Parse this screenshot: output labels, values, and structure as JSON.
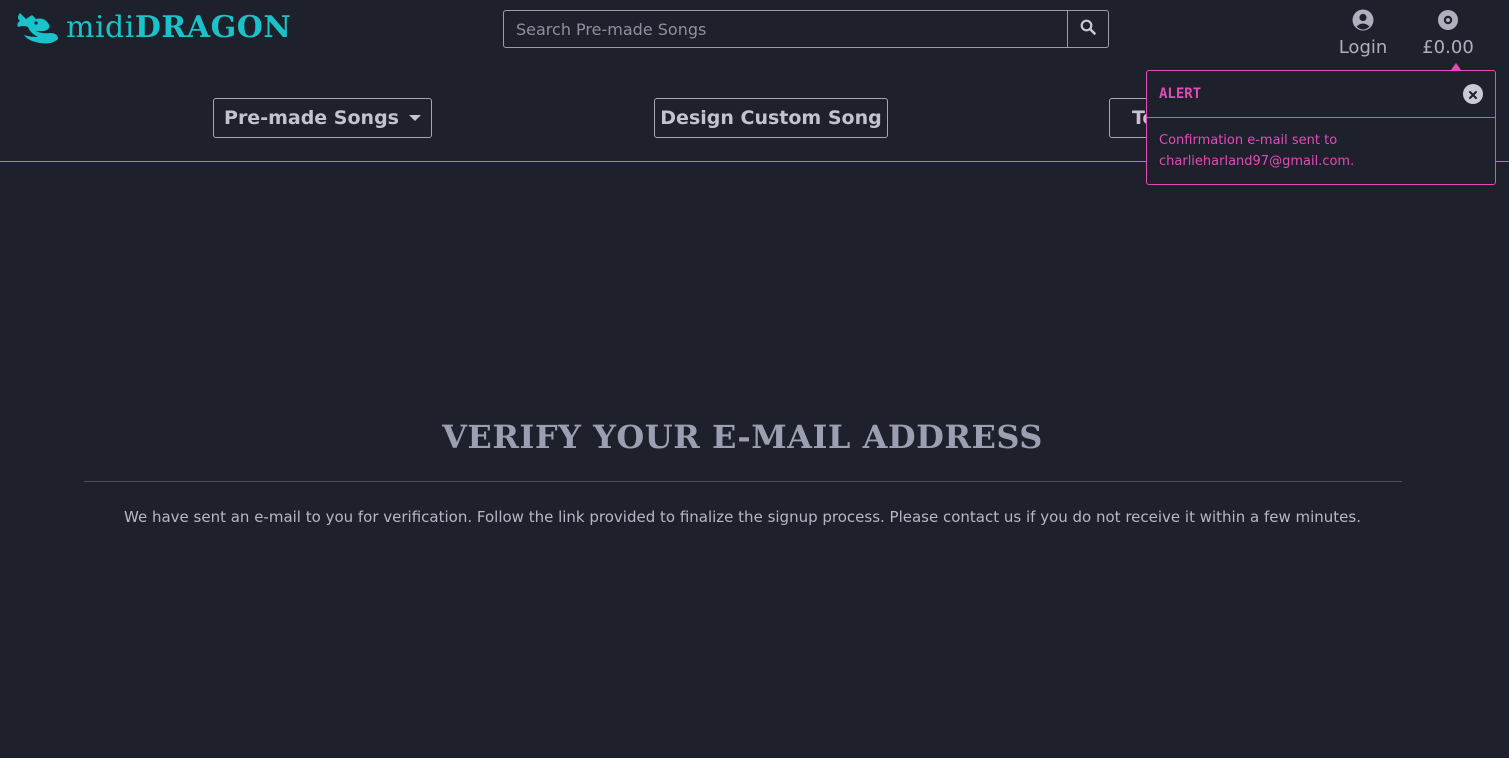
{
  "brand": {
    "name_light": "midi",
    "name_bold": "DRAGON",
    "logo_icon": "dragon-icon",
    "color": "#19c3c9"
  },
  "search": {
    "placeholder": "Search Pre-made Songs",
    "button_icon": "search-icon"
  },
  "account": {
    "icon": "user-circle-icon",
    "label": "Login"
  },
  "cart": {
    "icon": "disc-icon",
    "label": "£0.00"
  },
  "nav": {
    "premade_label": "Pre-made Songs",
    "premade_icon": "caret-down-icon",
    "design_label": "Design Custom Song",
    "third_label_visible": "To"
  },
  "main": {
    "heading": "VERIFY YOUR E-MAIL ADDRESS",
    "message": "We have sent an e-mail to you for verification. Follow the link provided to finalize the signup process. Please contact us if you do not receive it within a few minutes."
  },
  "alert": {
    "title": "ALERT",
    "close_icon": "close-icon",
    "line1": "Confirmation e-mail sent to",
    "line2": "charlieharland97@gmail.com.",
    "color": "#e04db8"
  },
  "colors": {
    "background": "#1e202b",
    "accent": "#19c3c9",
    "alert": "#e04db8"
  }
}
